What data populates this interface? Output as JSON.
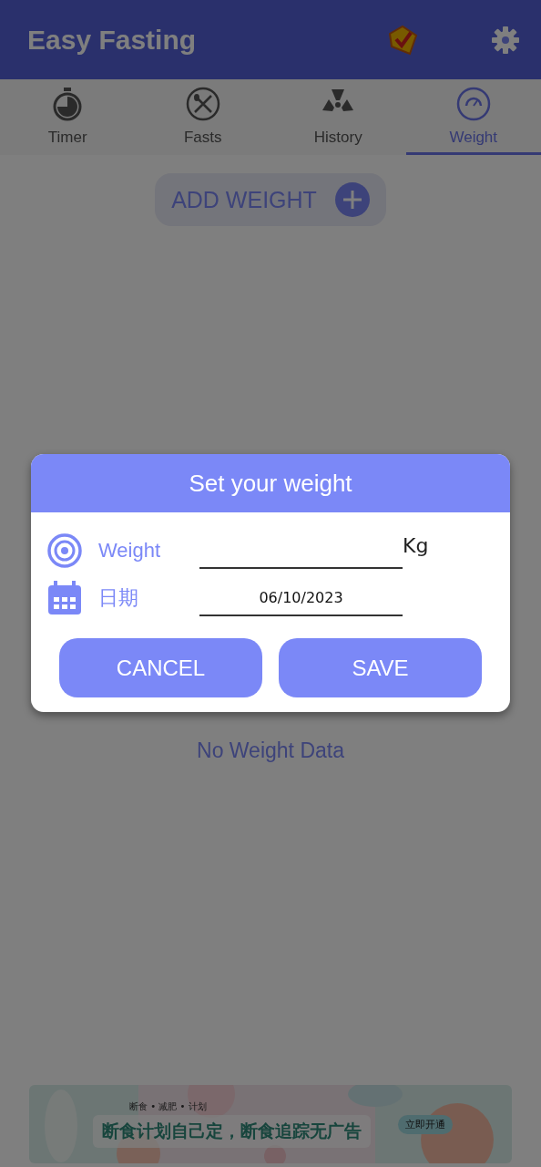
{
  "app_bar": {
    "title": "Easy Fasting"
  },
  "tabs": [
    {
      "label": "Timer",
      "kind": "timer",
      "selected": false
    },
    {
      "label": "Fasts",
      "kind": "fasts",
      "selected": false
    },
    {
      "label": "History",
      "kind": "history",
      "selected": false
    },
    {
      "label": "Weight",
      "kind": "weight",
      "selected": true
    }
  ],
  "add_button": {
    "label": "ADD WEIGHT"
  },
  "empty_message": "No Weight Data",
  "dialog": {
    "title": "Set your weight",
    "fields": [
      {
        "kind": "weight",
        "label": "Weight",
        "unit": "Kg"
      },
      {
        "kind": "date",
        "label": "日期",
        "value": "06/10/2023"
      }
    ],
    "buttons": [
      "CANCEL",
      "SAVE"
    ]
  },
  "ad_banner": {
    "tagline": "断食 • 减肥 • 计划",
    "headline": "断食计划自己定，断食追踪无广告",
    "action": "立即开通"
  }
}
